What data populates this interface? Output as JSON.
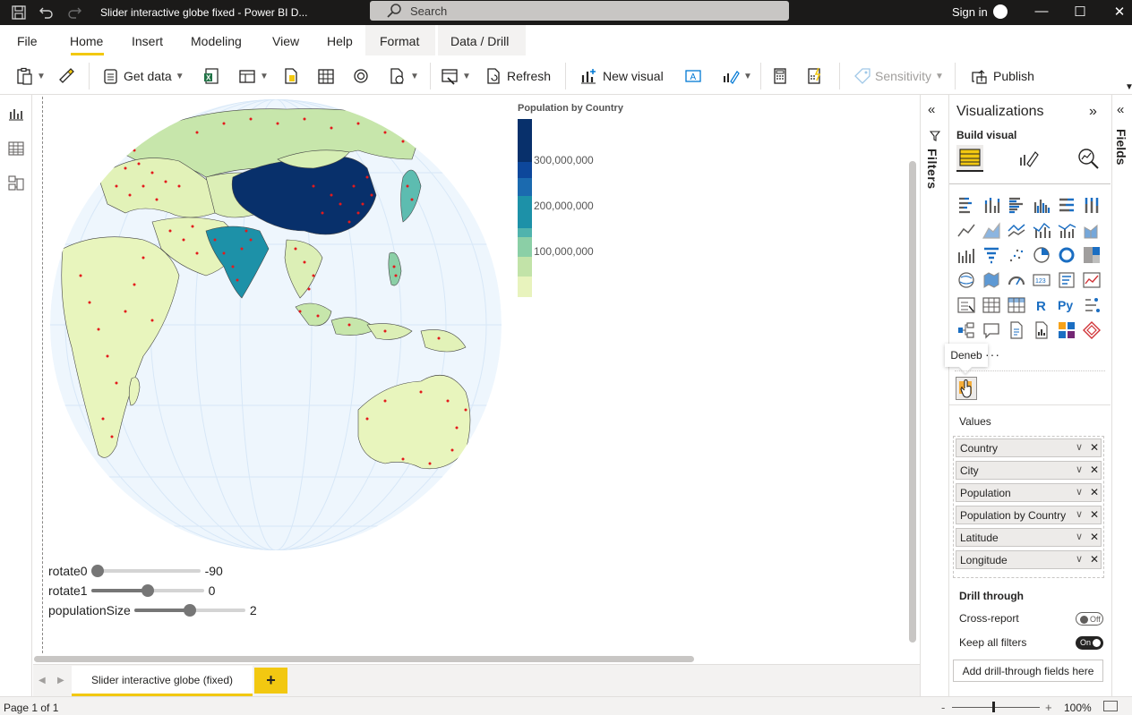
{
  "window": {
    "title": "Slider interactive globe fixed - Power BI D...",
    "search_placeholder": "Search",
    "signin": "Sign in",
    "controls": [
      "—",
      "☐",
      "✕"
    ]
  },
  "ribbon_tabs": [
    "File",
    "Home",
    "Insert",
    "Modeling",
    "View",
    "Help",
    "Format",
    "Data / Drill"
  ],
  "active_tab": "Home",
  "toolbar": {
    "get_data": "Get data",
    "refresh": "Refresh",
    "new_visual": "New visual",
    "sensitivity": "Sensitivity",
    "publish": "Publish"
  },
  "legend": {
    "title": "Population by Country",
    "labels": [
      "300,000,000",
      "200,000,000",
      "100,000,000"
    ],
    "colors": [
      "#e8f3bd",
      "#c2e3a8",
      "#8bcfa6",
      "#50b3ad",
      "#1d91a8",
      "#1b6aaf",
      "#0d479b",
      "#08306b"
    ]
  },
  "sliders": [
    {
      "label": "rotate0",
      "value": "-90",
      "fraction": 0.0
    },
    {
      "label": "rotate1",
      "value": "0",
      "fraction": 0.5
    },
    {
      "label": "populationSize",
      "value": "2",
      "fraction": 0.5
    }
  ],
  "pages": {
    "tab": "Slider interactive globe (fixed)",
    "add": "+",
    "status": "Page 1 of 1"
  },
  "zoom": {
    "minus": "-",
    "plus": "+",
    "percent": "100%"
  },
  "filters": {
    "label": "Filters"
  },
  "visualizations": {
    "title": "Visualizations",
    "build_visual": "Build visual",
    "tooltip": "Deneb",
    "values_label": "Values",
    "wells": [
      "Country",
      "City",
      "Population",
      "Population by Country",
      "Latitude",
      "Longitude"
    ],
    "drill_through": "Drill through",
    "cross_report": "Cross-report",
    "cross_report_state": "Off",
    "keep_all_filters": "Keep all filters",
    "keep_all_filters_state": "On",
    "add_drill": "Add drill-through fields here",
    "more": "···"
  },
  "fields": {
    "label": "Fields"
  },
  "accent_color": "#f2c811"
}
